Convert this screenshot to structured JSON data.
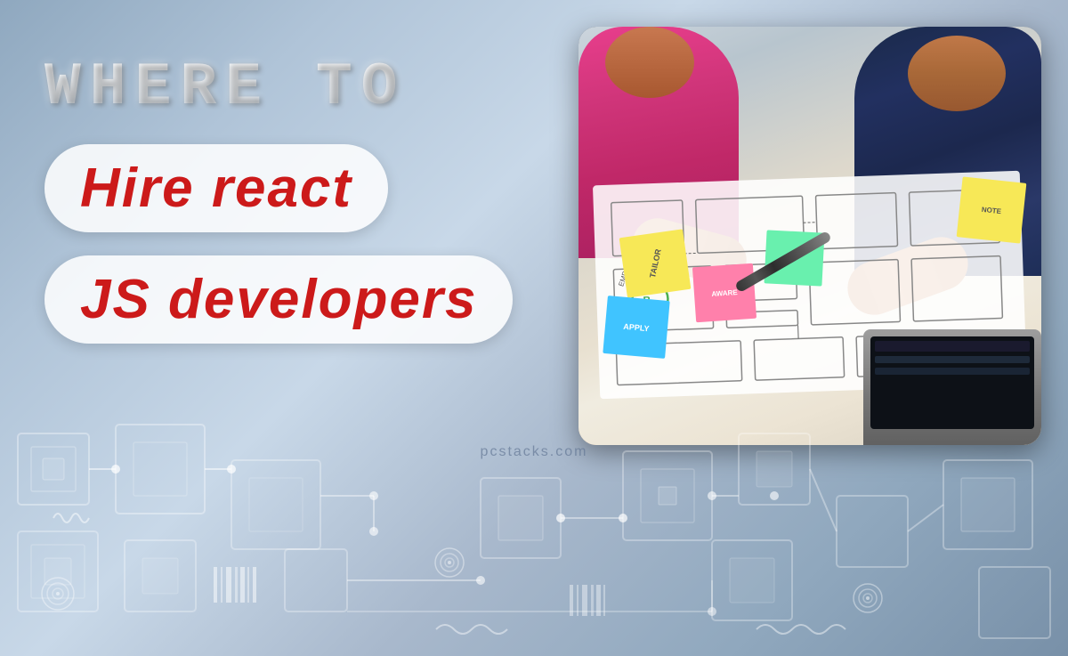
{
  "page": {
    "title": "Where to Hire React JS Developers",
    "background_colors": [
      "#8fa8bf",
      "#b0c4d8",
      "#c8d8e8"
    ],
    "watermark": "pcstacks.com"
  },
  "header": {
    "line1": "WHERE TO",
    "line2_badge1": "Hire react",
    "line2_badge2": "JS developers"
  },
  "image": {
    "alt": "Team working on wireframe designs with sticky notes"
  },
  "colors": {
    "text_red": "#cc1a1a",
    "badge_bg": "rgba(255,255,255,0.85)",
    "header_white": "#ffffff"
  }
}
